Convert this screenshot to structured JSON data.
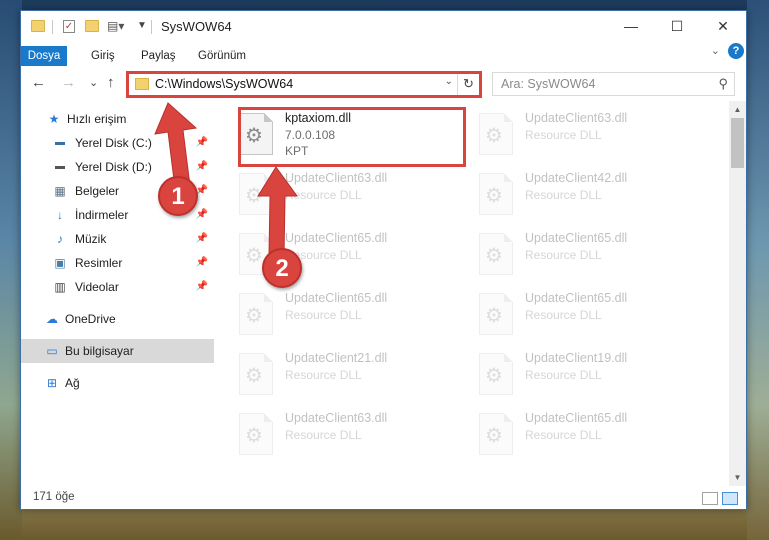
{
  "window": {
    "title": "SysWOW64"
  },
  "window_controls": {
    "minimize": "—",
    "maximize": "☐",
    "close": "✕"
  },
  "ribbon": {
    "tabs": [
      "Dosya",
      "Giriş",
      "Paylaş",
      "Görünüm"
    ],
    "help": "?",
    "collapse": "⌄"
  },
  "address": {
    "path": "C:\\Windows\\SysWOW64",
    "dropdown": "⌄",
    "refresh": "↻"
  },
  "search": {
    "placeholder": "Ara: SysWOW64",
    "icon": "search-icon"
  },
  "nav_buttons": {
    "back": "←",
    "forward": "→",
    "recent": "⌄",
    "up": "↑"
  },
  "sidebar": {
    "items": [
      {
        "label": "Hızlı erişim",
        "icon": "star-icon",
        "pinned": false
      },
      {
        "label": "Yerel Disk (C:)",
        "icon": "drive-icon",
        "pinned": true
      },
      {
        "label": "Yerel Disk (D:)",
        "icon": "drive-icon",
        "pinned": true
      },
      {
        "label": "Belgeler",
        "icon": "documents-icon",
        "pinned": true
      },
      {
        "label": "İndirmeler",
        "icon": "download-icon",
        "pinned": true
      },
      {
        "label": "Müzik",
        "icon": "music-icon",
        "pinned": true
      },
      {
        "label": "Resimler",
        "icon": "pictures-icon",
        "pinned": true
      },
      {
        "label": "Videolar",
        "icon": "videos-icon",
        "pinned": true
      },
      {
        "label": "OneDrive",
        "icon": "cloud-icon",
        "pinned": false
      },
      {
        "label": "Bu bilgisayar",
        "icon": "computer-icon",
        "pinned": false,
        "selected": true
      },
      {
        "label": "Ağ",
        "icon": "network-icon",
        "pinned": false
      }
    ]
  },
  "files": [
    {
      "name": "kptaxiom.dll",
      "line2": "7.0.0.108",
      "line3": "KPT",
      "highlighted": true
    },
    {
      "name": "UpdateClient63.dll",
      "line2": "Resource DLL"
    },
    {
      "name": "UpdateClient63.dll",
      "line2": "Resource DLL"
    },
    {
      "name": "UpdateClient42.dll",
      "line2": "Resource DLL"
    },
    {
      "name": "UpdateClient65.dll",
      "line2": "Resource DLL"
    },
    {
      "name": "UpdateClient65.dll",
      "line2": "Resource DLL"
    },
    {
      "name": "UpdateClient65.dll",
      "line2": "Resource DLL"
    },
    {
      "name": "UpdateClient65.dll",
      "line2": "Resource DLL"
    },
    {
      "name": "UpdateClient21.dll",
      "line2": "Resource DLL"
    },
    {
      "name": "UpdateClient19.dll",
      "line2": "Resource DLL"
    },
    {
      "name": "UpdateClient63.dll",
      "line2": "Resource DLL"
    },
    {
      "name": "UpdateClient65.dll",
      "line2": "Resource DLL"
    }
  ],
  "status": {
    "item_count": "171 öğe"
  },
  "annotations": {
    "step1": "1",
    "step2": "2",
    "color": "#d9443f"
  }
}
